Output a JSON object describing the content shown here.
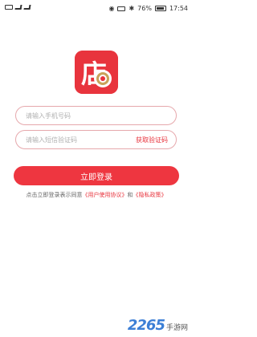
{
  "status_bar": {
    "battery": "76%",
    "time": "17:54"
  },
  "app": {
    "brand_color": "#e8343d",
    "logo_glyph": "店"
  },
  "form": {
    "phone_placeholder": "请输入手机号码",
    "phone_value": "",
    "code_placeholder": "请输入短信验证码",
    "code_value": "",
    "get_code_label": "获取验证码",
    "login_label": "立即登录"
  },
  "agreement": {
    "prefix": "点击立即登录表示同意",
    "user_agreement": "《用户使用协议》",
    "connector": "和",
    "privacy_policy": "《隐私政策》"
  },
  "watermark": {
    "number": "2265",
    "suffix": "手游网"
  }
}
